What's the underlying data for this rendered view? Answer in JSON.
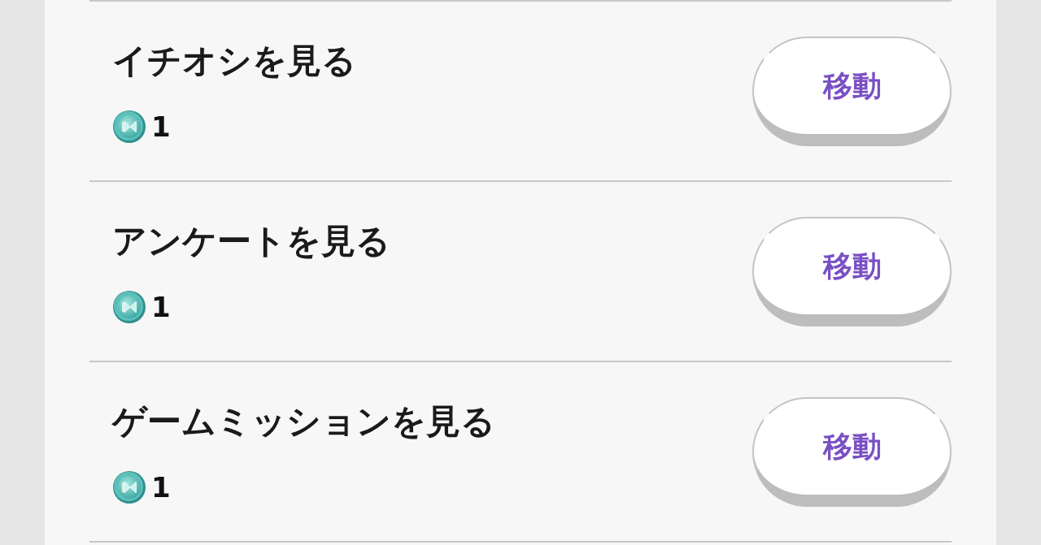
{
  "missions": [
    {
      "title": "イチオシを見る",
      "reward": "1",
      "button": "移動"
    },
    {
      "title": "アンケートを見る",
      "reward": "1",
      "button": "移動"
    },
    {
      "title": "ゲームミッションを見る",
      "reward": "1",
      "button": "移動"
    }
  ]
}
